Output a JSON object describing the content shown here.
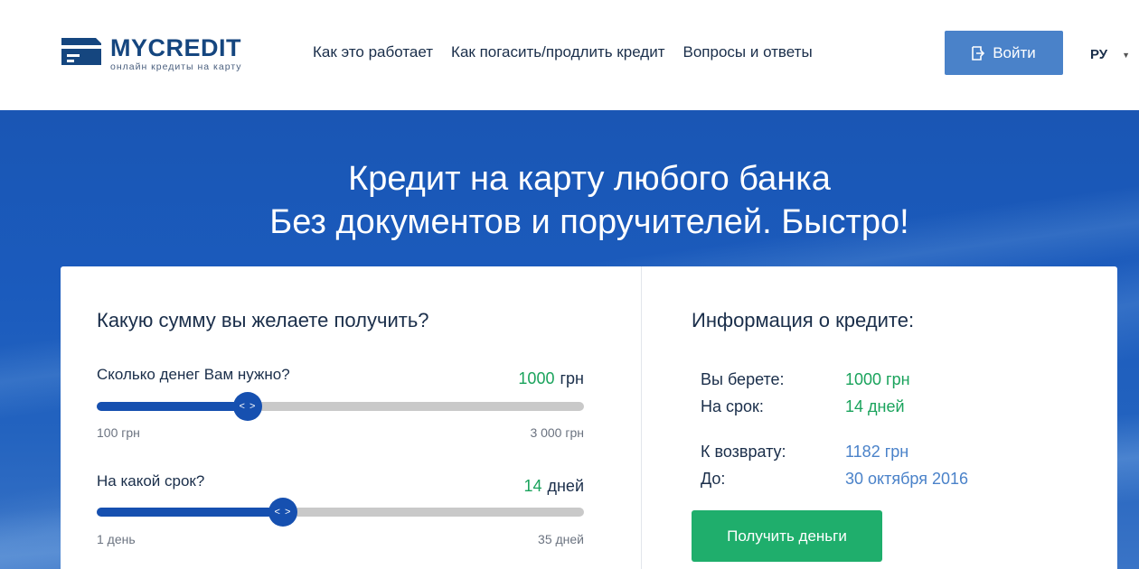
{
  "brand": {
    "name_part1": "MY",
    "name_part2": "CREDIT",
    "tagline": "онлайн кредиты на карту"
  },
  "nav": {
    "items": [
      {
        "label": "Как это работает"
      },
      {
        "label": "Как погасить/продлить кредит"
      },
      {
        "label": "Вопросы и ответы"
      }
    ],
    "login_label": "Войти",
    "language": "РУ"
  },
  "hero": {
    "line1": "Кредит на карту любого банка",
    "line2": "Без документов и поручителей. Быстро!"
  },
  "calculator": {
    "title": "Какую сумму вы желаете получить?",
    "amount": {
      "label": "Сколько денег Вам нужно?",
      "value": "1000",
      "unit": "грн",
      "min_label": "100 грн",
      "max_label": "3 000 грн",
      "min": 100,
      "max": 3000,
      "current": 1000,
      "handle_text": "< >"
    },
    "term": {
      "label": "На какой срок?",
      "value": "14",
      "unit": "дней",
      "min_label": "1 день",
      "max_label": "35 дней",
      "min": 1,
      "max": 35,
      "current": 14,
      "handle_text": "< >"
    }
  },
  "info": {
    "title": "Информация о кредите:",
    "rows": [
      {
        "key": "Вы берете:",
        "value": "1000 грн"
      },
      {
        "key": "На срок:",
        "value": "14 дней"
      },
      {
        "key": "К возврату:",
        "value": "1182 грн"
      },
      {
        "key": "До:",
        "value": "30 октября 2016"
      }
    ],
    "cta_label": "Получить деньги"
  },
  "colors": {
    "brand_blue": "#15467f",
    "accent_blue": "#4a82c9",
    "slider_blue": "#1650b0",
    "green": "#1aa35c",
    "cta_green": "#1fae6c"
  },
  "icons": {
    "logo": "credit-card-logo-icon",
    "login": "sign-in-icon",
    "language_caret": "caret-down-icon"
  }
}
